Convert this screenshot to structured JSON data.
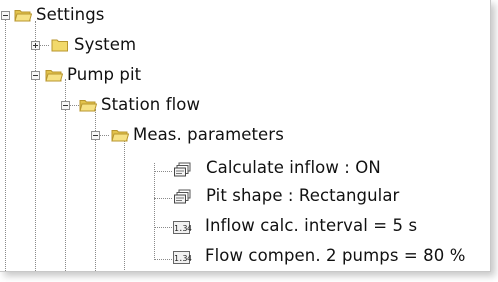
{
  "tree": {
    "settings": {
      "label": "Settings"
    },
    "system": {
      "label": "System"
    },
    "pump_pit": {
      "label": "Pump pit"
    },
    "station_flow": {
      "label": "Station flow"
    },
    "meas_parameters": {
      "label": "Meas. parameters"
    },
    "params": [
      {
        "label": "Calculate inflow : ON",
        "icon": "dialog-icon"
      },
      {
        "label": "Pit shape : Rectangular",
        "icon": "dialog-icon"
      },
      {
        "label": "Inflow calc. interval = 5 s",
        "icon": "numeric-icon",
        "icon_text": "1.34"
      },
      {
        "label": "Flow compen. 2 pumps = 80 %",
        "icon": "numeric-icon",
        "icon_text": "1.34"
      }
    ]
  },
  "colors": {
    "folder_fill": "#f2d96a",
    "folder_edge": "#b8962e",
    "guide_line": "#8a8a8a"
  }
}
